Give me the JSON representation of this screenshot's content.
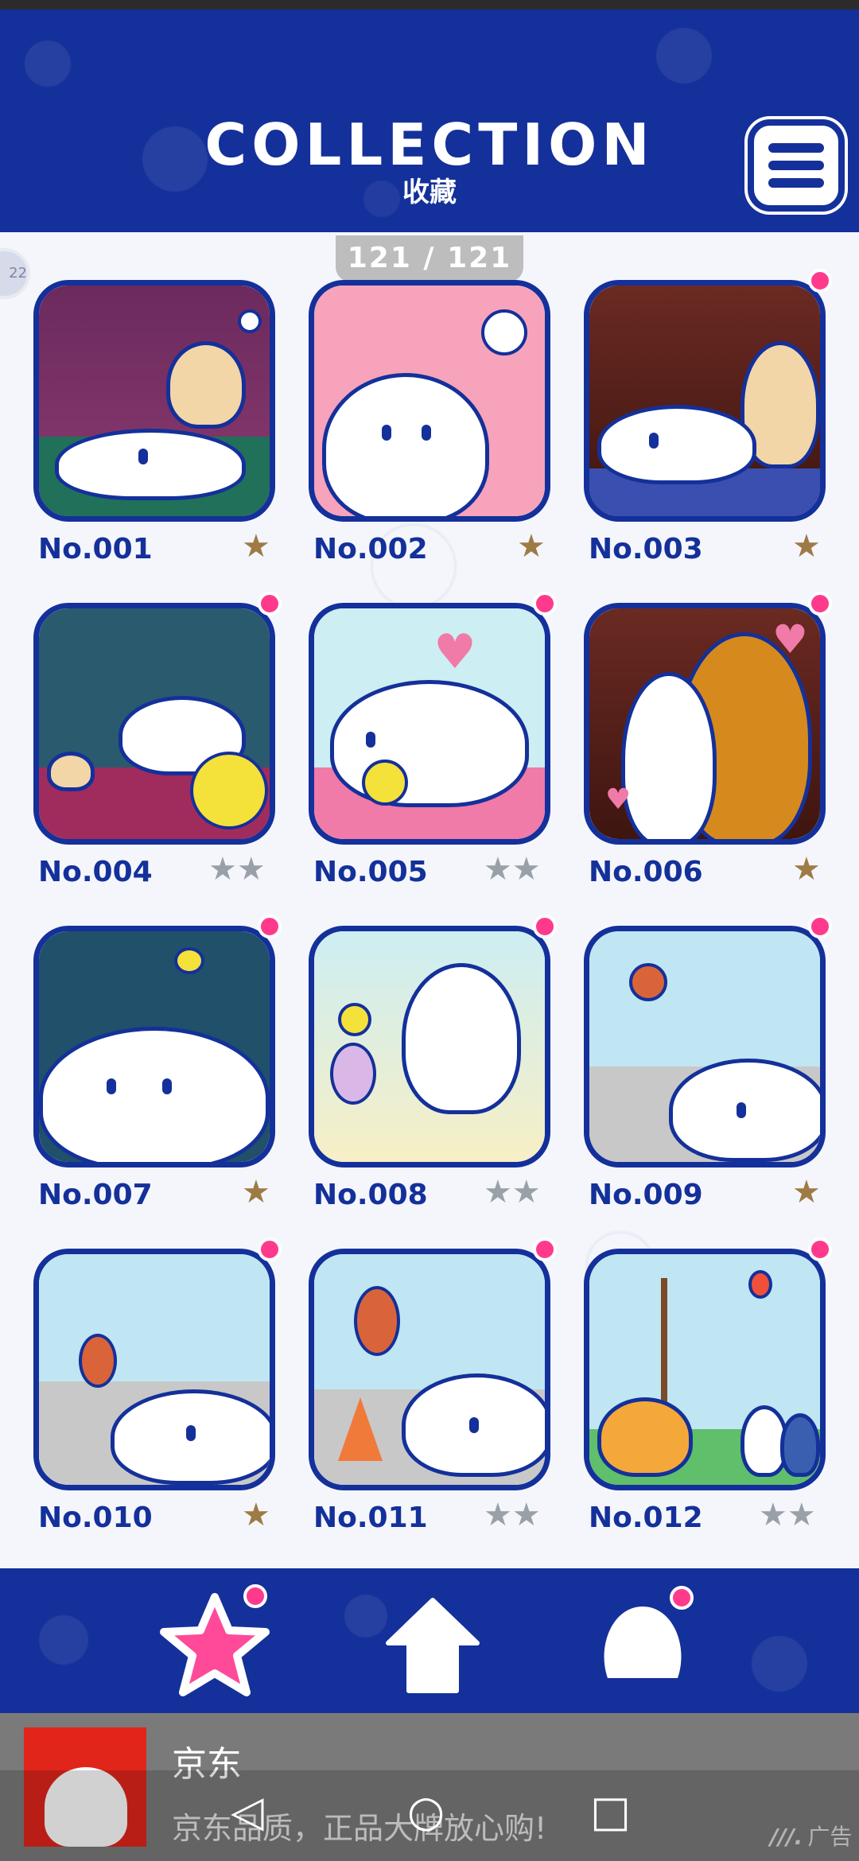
{
  "header": {
    "title": "COLLECTION",
    "subtitle": "收藏",
    "menu_icon": "hamburger-menu-icon"
  },
  "counter": "121 / 121",
  "side_bubble": "22",
  "cards": [
    {
      "num": "No.001",
      "stars": "★",
      "rating": 1,
      "new": false
    },
    {
      "num": "No.002",
      "stars": "★",
      "rating": 1,
      "new": false
    },
    {
      "num": "No.003",
      "stars": "★",
      "rating": 1,
      "new": true
    },
    {
      "num": "No.004",
      "stars": "★★",
      "rating": 2,
      "new": true
    },
    {
      "num": "No.005",
      "stars": "★★",
      "rating": 2,
      "new": true
    },
    {
      "num": "No.006",
      "stars": "★",
      "rating": 1,
      "new": true
    },
    {
      "num": "No.007",
      "stars": "★",
      "rating": 1,
      "new": true
    },
    {
      "num": "No.008",
      "stars": "★★",
      "rating": 2,
      "new": true
    },
    {
      "num": "No.009",
      "stars": "★",
      "rating": 1,
      "new": true
    },
    {
      "num": "No.010",
      "stars": "★",
      "rating": 1,
      "new": true
    },
    {
      "num": "No.011",
      "stars": "★★",
      "rating": 2,
      "new": true
    },
    {
      "num": "No.012",
      "stars": "★★",
      "rating": 2,
      "new": true
    }
  ],
  "bottom_nav": {
    "items": [
      "star-icon",
      "home-icon",
      "dog-icon"
    ]
  },
  "ad": {
    "title": "京东",
    "description": "京东品质，正品大牌放心购!",
    "tag": "广告"
  },
  "colors": {
    "brand_blue": "#14309a",
    "new_dot": "#ff3a8c",
    "star_gold": "#9e7a45",
    "star_grey": "#9aa0a8"
  }
}
